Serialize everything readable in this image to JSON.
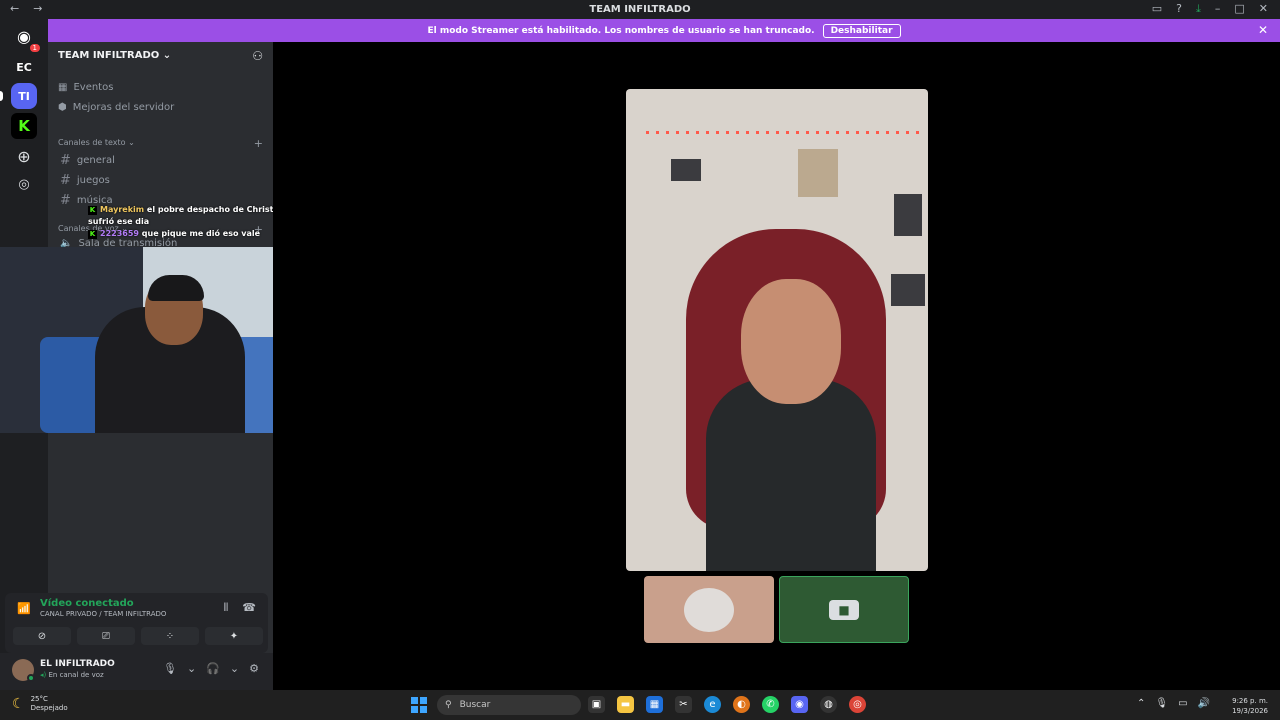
{
  "window": {
    "title": "TEAM INFILTRADO"
  },
  "banner": {
    "text": "El modo Streamer está habilitado. Los nombres de usuario se han truncado.",
    "button": "Deshabilitar"
  },
  "guilds": {
    "home_badge": "1",
    "ec": "EC",
    "ti": "TI"
  },
  "server": {
    "name": "TEAM INFILTRADO",
    "events": "Eventos",
    "boosts": "Mejoras del servidor",
    "text_category": "Canales de texto",
    "text_channels": [
      "general",
      "juegos",
      "música"
    ],
    "voice_category": "Canales de voz",
    "voice_channel": "Sala de transmisión"
  },
  "chat_overlay": [
    {
      "user": "Mayrekim",
      "message": "el pobre despacho de Christopher sufrió ese dia"
    },
    {
      "user": "2223659",
      "message": "que pique me dió eso vale"
    }
  ],
  "voice": {
    "status": "Vídeo conectado",
    "channel": "CANAL PRIVADO / TEAM INFILTRADO"
  },
  "user": {
    "name": "EL INFILTRADO",
    "status": "En canal de voz"
  },
  "taskbar": {
    "temperature": "25°C",
    "condition": "Despejado",
    "search_placeholder": "Buscar",
    "time": "9:26 p. m.",
    "date": "19/3/2026"
  },
  "colors": {
    "accent": "#5865f2",
    "banner": "#9b4fe6",
    "connected": "#23a55a",
    "kick": "#53fc18"
  }
}
